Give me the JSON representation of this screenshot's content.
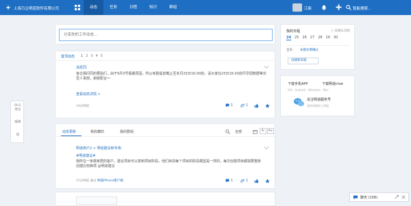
{
  "topbar": {
    "company": "上海万企明道软件有限公司",
    "nav": [
      "动态",
      "任务",
      "日程",
      "知识",
      "群组"
    ],
    "active_nav": 0,
    "user_name": "江新",
    "search_placeholder": "智能搜索..."
  },
  "composer": {
    "placeholder": "分享你的工作动态..."
  },
  "feed1": {
    "header": "置顶动态",
    "pages": [
      "1",
      "2",
      "3",
      "4",
      "5"
    ],
    "current_page": 0,
    "post": {
      "author": "消息同:",
      "body": "各位相问同的要贴们，由于9月3号假期原因，所以考勤提前截止至本月25日16:00前，请大家在25日16:00前尽早把数据等交至人事部，谢谢配合～",
      "link": "查看动态详情 >",
      "time": "28分钟前",
      "reply_count": "1",
      "attach_count": "1"
    }
  },
  "schedule": {
    "title": "我的日程",
    "unread": "○ 未确认日程",
    "days": [
      "24",
      "25",
      "26",
      "27",
      "28",
      "29",
      "30"
    ],
    "today_index": 0,
    "allday_label": "全天",
    "task": "长假文章确认",
    "create_button": "创建新日程"
  },
  "download": {
    "mobile": "下载手机APP",
    "desktop": "下载明道chat",
    "platforms": "iOS · Android · Windows · Mac",
    "follow": "关注明道服务号",
    "follow_sub": "用你的微信上明道"
  },
  "float_panel": {
    "items": [
      "BUG\n建议",
      "编辑",
      "帮"
    ]
  },
  "feed2": {
    "tabs": [
      "动态更新",
      "我收藏的",
      "我的群组"
    ],
    "active_tab": 0,
    "filter_all": "全部",
    "font_down": "A-",
    "font_up": "A+",
    "post": {
      "author": "明道用户2 > 明道建议和专场:",
      "tag": "#明道建议#",
      "body": "我所在一家做家居的客户，建议项目可以复制项目阶段，他们目前每个项目的阶段模型是一样的，每次创建项目都需要重新创建比较麻烦 @明道建议",
      "time": "25分钟前",
      "via_label": "通过",
      "via_app": "明道iPhone客户端",
      "reply_count": "1",
      "attach_count": "1"
    }
  },
  "chat": {
    "label": "聊天 (158)"
  }
}
